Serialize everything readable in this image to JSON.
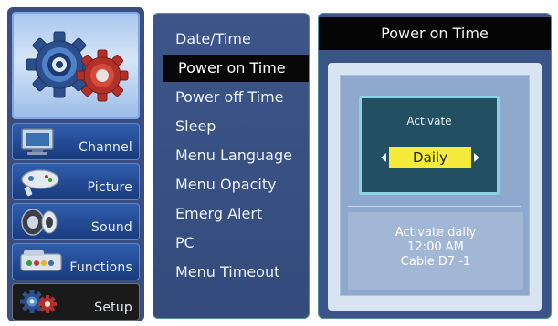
{
  "categories": [
    {
      "label": "Channel",
      "icon": "tv-icon"
    },
    {
      "label": "Picture",
      "icon": "gamepad-icon"
    },
    {
      "label": "Sound",
      "icon": "speaker-icon"
    },
    {
      "label": "Functions",
      "icon": "console-icon"
    },
    {
      "label": "Setup",
      "icon": "gears-icon",
      "active": true
    }
  ],
  "menu": {
    "items": [
      "Date/Time",
      "Power on Time",
      "Power off Time",
      "Sleep",
      "Menu Language",
      "Menu Opacity",
      "Emerg Alert",
      "PC",
      "Menu Timeout"
    ],
    "selected_index": 1
  },
  "detail": {
    "title": "Power on Time",
    "activate_label": "Activate",
    "activate_value": "Daily",
    "info_line1": "Activate daily",
    "info_line2": "12:00 AM",
    "info_line3": "Cable D7 -1"
  },
  "colors": {
    "panel_blue": "#3a5388",
    "selection_black": "#070707",
    "value_yellow": "#f6ea3b",
    "accent_cyan": "#8ad1e6"
  }
}
